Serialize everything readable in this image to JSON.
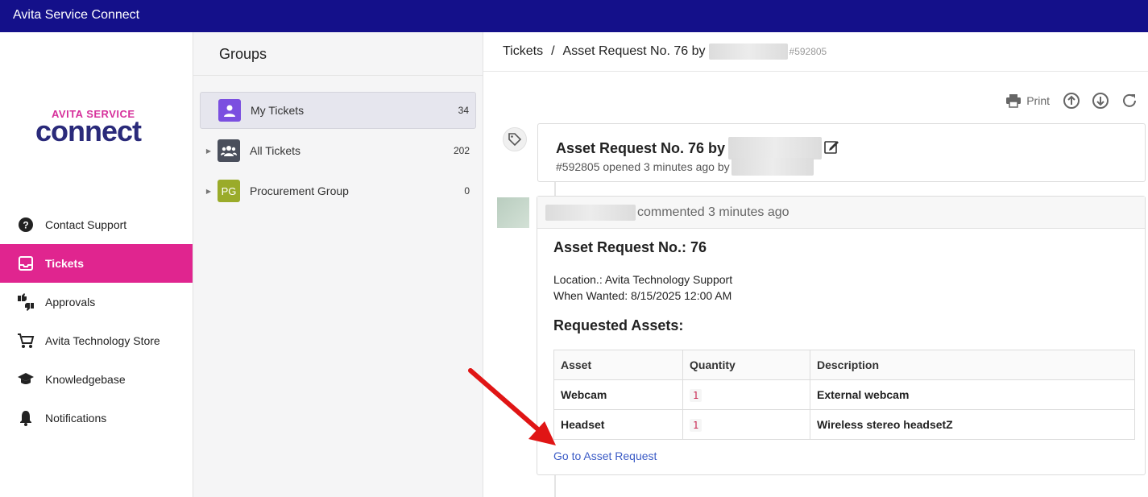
{
  "app": {
    "title": "Avita Service Connect"
  },
  "logo": {
    "line1": "AVITA SERVICE",
    "line2": "connect"
  },
  "sidebar": {
    "items": [
      {
        "label": "Contact Support",
        "icon": "help-circle-icon"
      },
      {
        "label": "Tickets",
        "icon": "inbox-icon",
        "active": true
      },
      {
        "label": "Approvals",
        "icon": "thumbs-up-down-icon"
      },
      {
        "label": "Avita Technology Store",
        "icon": "cart-icon"
      },
      {
        "label": "Knowledgebase",
        "icon": "graduation-cap-icon"
      },
      {
        "label": "Notifications",
        "icon": "bell-icon"
      }
    ],
    "active_color": "#e0258f"
  },
  "groups": {
    "heading": "Groups",
    "items": [
      {
        "label": "My Tickets",
        "count": "34",
        "avatar": "person-icon",
        "avatar_color": "#7b4fe0"
      },
      {
        "label": "All Tickets",
        "count": "202",
        "avatar": "group-icon",
        "avatar_color": "#4a4f5c"
      },
      {
        "label": "Procurement Group",
        "count": "0",
        "avatar_text": "PG",
        "avatar_color": "#9aab2a"
      }
    ]
  },
  "main": {
    "breadcrumb": {
      "root": "Tickets",
      "separator": "/",
      "current": "Asset Request No. 76 by",
      "number": "#592805"
    },
    "toolbar": {
      "print_label": "Print"
    },
    "ticket": {
      "title": "Asset Request No. 76 by",
      "sub": "#592805 opened 3 minutes ago by"
    },
    "comment": {
      "header": "commented 3 minutes ago",
      "heading": "Asset Request No.: 76",
      "location": "Location.: Avita Technology Support",
      "when": "When Wanted: 8/15/2025 12:00 AM",
      "assets_heading": "Requested Assets:",
      "table": {
        "headers": [
          "Asset",
          "Quantity",
          "Description"
        ],
        "rows": [
          [
            "Webcam",
            "1",
            "External webcam"
          ],
          [
            "Headset",
            "1",
            "Wireless stereo headsetZ"
          ]
        ]
      },
      "link": "Go to Asset Request"
    }
  },
  "colors": {
    "topbar": "#14108a",
    "accent": "#e0258f",
    "link": "#3b5bc6",
    "annotation_arrow": "#e01515"
  }
}
